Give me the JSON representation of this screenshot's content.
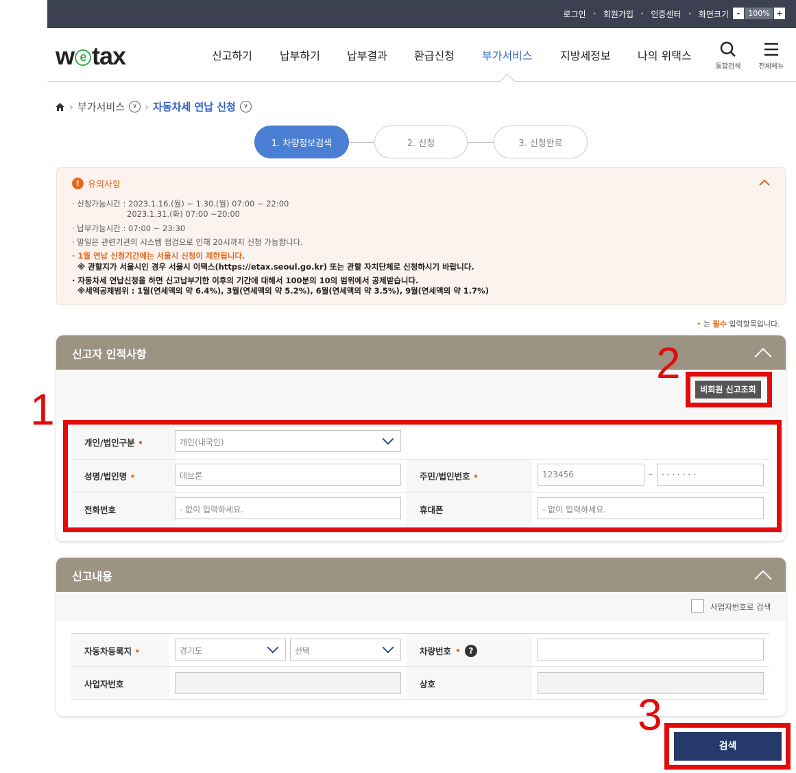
{
  "topbar": {
    "links": [
      "로그인",
      "회원가입",
      "인증센터",
      "화면크기"
    ],
    "zoom_minus": "-",
    "zoom_value": "100%",
    "zoom_plus": "+"
  },
  "logo": {
    "w": "w",
    "e": "e",
    "tax": "tax"
  },
  "nav": {
    "items": [
      "신고하기",
      "납부하기",
      "납부결과",
      "환급신청",
      "부가서비스",
      "지방세정보",
      "나의 위택스"
    ],
    "search_label": "통합검색",
    "menu_label": "전체메뉴"
  },
  "breadcrumb": {
    "level1": "부가서비스",
    "level2": "자동차세 연납 신청"
  },
  "steps": [
    "1. 차량정보검색",
    "2. 신청",
    "3. 신청완료"
  ],
  "notice": {
    "title": "유의사항",
    "lines": [
      "· 신청가능시간 : 2023.1.16.(월) ~ 1.30.(월) 07:00 ~ 22:00",
      "2023.1.31.(화) 07:00 ~20:00",
      "· 납부가능시간 : 07:00 ~ 23:30",
      "· 말일은 관련기관의 시스템 점검으로 인해 20시까지 신청 가능합니다.",
      "· 1월 연납 신청기간에는 서울시 신청이 제한됩니다.",
      "※ 관할지가 서울시인 경우 서울시 이택스(https://etax.seoul.go.kr) 또는 관할 자치단체로 신청하시기 바랍니다.",
      "· 자동차세 연납신청을 하면 신고납부기한 이후의 기간에 대해서 100분의 10의 범위에서 공제받습니다.",
      "※세액공제범위 : 1월(연세액의 약 6.4%), 3월(연세액의 약 5.2%), 6월(연세액의 약 3.5%), 9월(연세액의 약 1.7%)"
    ]
  },
  "required_note": {
    "bullet": "•",
    "pre": "는 ",
    "strong": "필수",
    "post": " 입력항목입니다."
  },
  "reporter": {
    "title": "신고자 인적사항",
    "guest_button": "비회원 신고조회",
    "type_label": "개인/법인구분",
    "type_value": "개인(내국인)",
    "name_label": "성명/법인명",
    "name_value": "데브론",
    "id_label": "주민/법인번호",
    "id_front": "123456",
    "id_dash": "–",
    "id_back": "· · · · · · ·",
    "phone_label": "전화번호",
    "phone_placeholder": "- 없이 입력하세요.",
    "mobile_label": "휴대폰",
    "mobile_placeholder": "- 없이 입력하세요.",
    "req_mark": "•"
  },
  "report": {
    "title": "신고내용",
    "biz_search_label": "사업자번호로 검색",
    "region_label": "자동차등록지",
    "region_value": "경기도",
    "region2_value": "선택",
    "car_label": "차량번호",
    "help": "?",
    "biz_label": "사업자번호",
    "company_label": "상호"
  },
  "search_button": "검색",
  "annotations": [
    "1",
    "2",
    "3"
  ]
}
